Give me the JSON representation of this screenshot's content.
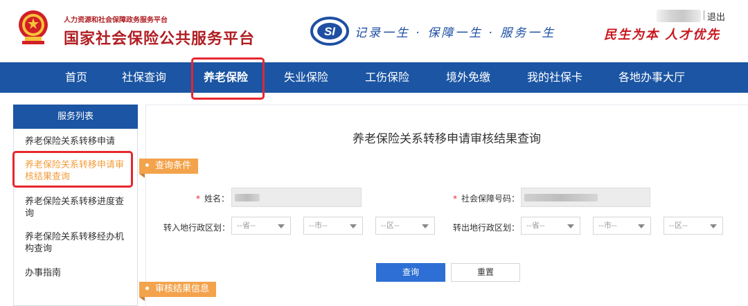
{
  "header": {
    "org_small": "人力资源和社会保障政务服务平台",
    "org_big": "国家社会保险公共服务平台",
    "logo_text": "SI",
    "slogan": "记录一生 · 保障一生 · 服务一生",
    "motto": "民生为本 人才优先",
    "logout": "退出",
    "colors": {
      "brand_red": "#b01e23",
      "brand_blue": "#1e4fa3"
    }
  },
  "nav": {
    "items": [
      "首页",
      "社保查询",
      "养老保险",
      "失业保险",
      "工伤保险",
      "境外免缴",
      "我的社保卡",
      "各地办事大厅"
    ],
    "active_index": 2,
    "color": "#1b55a3"
  },
  "sidebar": {
    "header": "服务列表",
    "items": [
      "养老保险关系转移申请",
      "养老保险关系转移申请审核结果查询",
      "养老保险关系转移进度查询",
      "养老保险关系转移经办机构查询",
      "办事指南"
    ],
    "active_index": 1
  },
  "main": {
    "title": "养老保险关系转移申请审核结果查询",
    "section_query": "查询条件",
    "section_result": "审核结果信息",
    "form": {
      "name_label": "姓名：",
      "ssn_label": "社会保障号码：",
      "required_mark": "*",
      "transfer_in_label": "转入地行政区划：",
      "transfer_out_label": "转出地行政区划：",
      "province_placeholder": "--省--",
      "city_placeholder": "--市--",
      "district_placeholder": "--区--"
    },
    "buttons": {
      "query": "查询",
      "reset": "重置"
    },
    "accent": "#f3a34c"
  }
}
